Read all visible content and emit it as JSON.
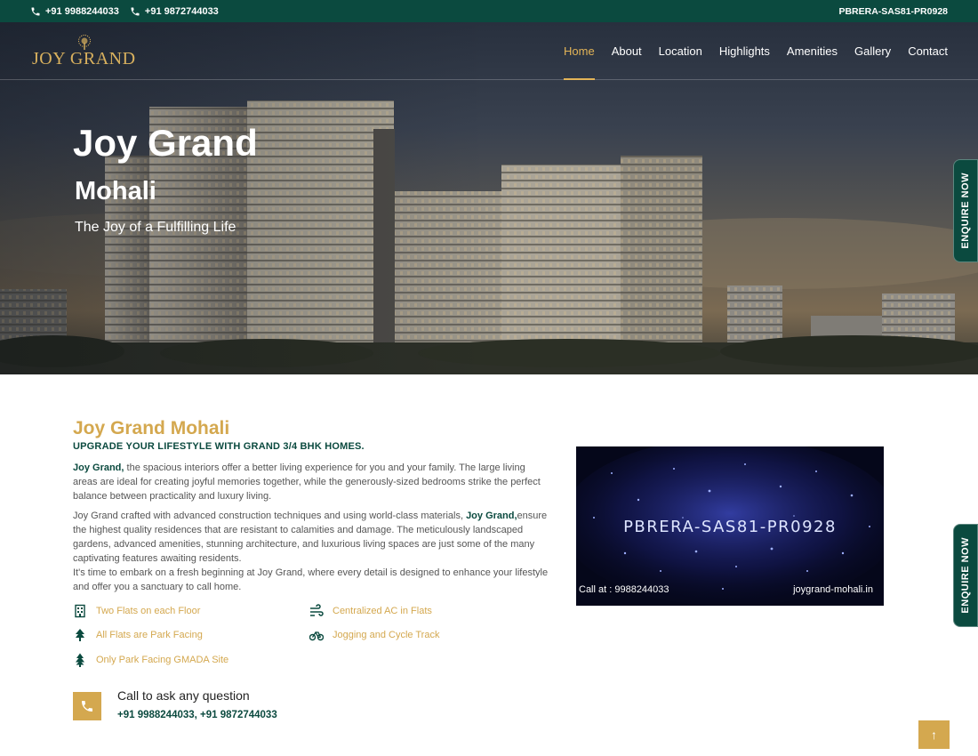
{
  "topbar": {
    "phone1": "+91 9988244033",
    "phone2": "+91 9872744033",
    "rera": "PBRERA-SAS81-PR0928"
  },
  "logo": {
    "text": "JOY GRAND"
  },
  "nav": {
    "items": [
      "Home",
      "About",
      "Location",
      "Highlights",
      "Amenities",
      "Gallery",
      "Contact"
    ],
    "active": "Home"
  },
  "hero": {
    "title": "Joy Grand",
    "subtitle": "Mohali",
    "tagline": "The Joy of a Fulfilling Life"
  },
  "enquire": {
    "label": "ENQUIRE NOW"
  },
  "about": {
    "heading": "Joy Grand Mohali",
    "subheading": "UPGRADE YOUR LIFESTYLE WITH GRAND 3/4 BHK HOMES.",
    "p1_bold": "Joy Grand,",
    "p1_text": " the spacious interiors offer a better living experience for you and your family. The large living areas are ideal for creating joyful memories together, while the generously-sized bedrooms strike the perfect balance between practicality and luxury living.",
    "p2_text_a": "Joy Grand crafted with advanced construction techniques and using world-class materials, ",
    "p2_bold": "Joy Grand,",
    "p2_text_b": "ensure the highest quality residences that are resistant to calamities and damage. The meticulously landscaped gardens, advanced amenities, stunning architecture, and luxurious living spaces are just some of the many captivating features awaiting residents.",
    "p3_text": "It's time to embark on a fresh beginning at Joy Grand, where every detail is designed to enhance your lifestyle and offer you a sanctuary to call home."
  },
  "features": [
    {
      "label": "Two Flats on each Floor",
      "icon": "building-icon"
    },
    {
      "label": "Centralized AC in Flats",
      "icon": "wind-icon"
    },
    {
      "label": "All Flats are Park Facing",
      "icon": "tree-icon"
    },
    {
      "label": "Jogging and Cycle Track",
      "icon": "bicycle-icon"
    },
    {
      "label": "Only Park Facing GMADA Site",
      "icon": "pine-tree-icon"
    }
  ],
  "call": {
    "question": "Call to ask any question",
    "numbers": "+91 9988244033,  +91 9872744033"
  },
  "video": {
    "code": "PBRERA-SAS81-PR0928",
    "call_at": "Call at : 9988244033",
    "site": "joygrand-mohali.in"
  },
  "scroll_top": {
    "glyph": "↑"
  },
  "colors": {
    "brand_green": "#0b4a3f",
    "gold": "#d4a84f",
    "nav_active": "#e3b457"
  }
}
